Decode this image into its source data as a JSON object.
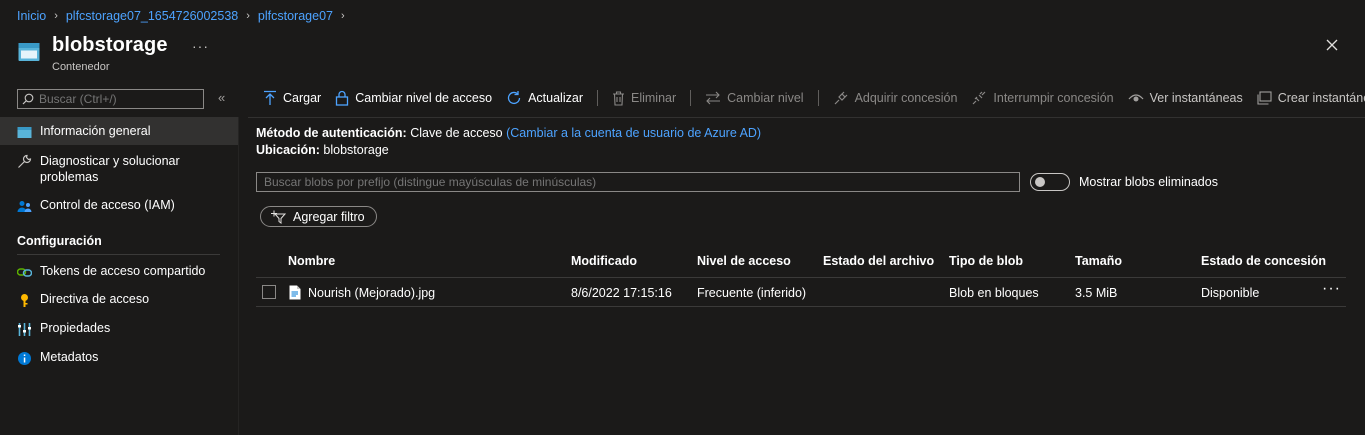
{
  "breadcrumb": [
    "Inicio",
    "plfcstorage07_1654726002538",
    "plfcstorage07"
  ],
  "header": {
    "title": "blobstorage",
    "subtitle": "Contenedor",
    "more": "···"
  },
  "sidebar": {
    "search_placeholder": "Buscar (Ctrl+/)",
    "collapse": "«",
    "items": [
      {
        "label": "Información general",
        "icon": "overview-icon",
        "active": true
      },
      {
        "label": "Diagnosticar y solucionar problemas",
        "icon": "wrench-icon"
      },
      {
        "label": "Control de acceso (IAM)",
        "icon": "people-icon"
      }
    ],
    "section": "Configuración",
    "config_items": [
      {
        "label": "Tokens de acceso compartido",
        "icon": "link-icon"
      },
      {
        "label": "Directiva de acceso",
        "icon": "key-icon"
      },
      {
        "label": "Propiedades",
        "icon": "properties-icon"
      },
      {
        "label": "Metadatos",
        "icon": "info-icon"
      }
    ]
  },
  "toolbar": {
    "upload": "Cargar",
    "change_access": "Cambiar nivel de acceso",
    "refresh": "Actualizar",
    "delete": "Eliminar",
    "change_tier": "Cambiar nivel",
    "acquire_lease": "Adquirir concesión",
    "break_lease": "Interrumpir concesión",
    "view_snapshots": "Ver instantáneas",
    "create_snapshot": "Crear instantánea"
  },
  "info": {
    "auth_label": "Método de autenticación:",
    "auth_value": "Clave de acceso",
    "auth_link": "(Cambiar a la cuenta de usuario de Azure AD)",
    "location_label": "Ubicación:",
    "location_value": "blobstorage"
  },
  "blob_search_placeholder": "Buscar blobs por prefijo (distingue mayúsculas de minúsculas)",
  "show_deleted_label": "Mostrar blobs eliminados",
  "show_deleted_on": false,
  "add_filter": "Agregar filtro",
  "table": {
    "columns": [
      "Nombre",
      "Modificado",
      "Nivel de acceso",
      "Estado del archivo",
      "Tipo de blob",
      "Tamaño",
      "Estado de concesión"
    ],
    "rows": [
      {
        "name": "Nourish (Mejorado).jpg",
        "modified": "8/6/2022 17:15:16",
        "access_tier": "Frecuente (inferido)",
        "archive_status": "",
        "blob_type": "Blob en bloques",
        "size": "3.5 MiB",
        "lease_state": "Disponible"
      }
    ],
    "row_menu": "···"
  },
  "colors": {
    "accent": "#4da3ff",
    "background": "#1b1a19",
    "active_nav": "#323130"
  }
}
